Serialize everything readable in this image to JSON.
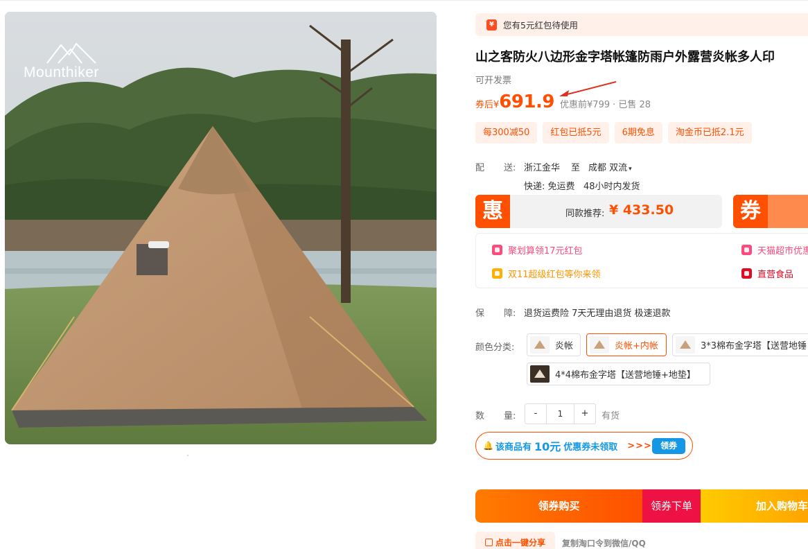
{
  "gallery": {
    "brand_name": "Mounthiker",
    "tent_label": "Mounthiker"
  },
  "redpacket": {
    "icon_glyph": "¥",
    "text": "您有5元红包待使用"
  },
  "product": {
    "title": "山之客防火八边形金字塔帐篷防雨户外露营炎帐多人印",
    "invoice": "可开发票"
  },
  "price": {
    "prefix": "券后¥",
    "main": "691.9",
    "original": "优惠前¥799",
    "sold": "· 已售 28"
  },
  "promos": [
    "每300减50",
    "红包已抵5元",
    "6期免息",
    "淘金币已抵2.1元"
  ],
  "delivery": {
    "label_a": "配",
    "label_b": "送:",
    "from": "浙江金华",
    "to_word": "至",
    "dest": "成都 双流",
    "express": "快递: 免运费",
    "ship_time": "48小时内发货"
  },
  "recommend": {
    "badge": "惠",
    "label": "同款推荐:",
    "price": "¥ 433.50",
    "coupon_badge": "券"
  },
  "benefits": {
    "item1": "聚划算领17元红包",
    "item2": "天猫超市优惠",
    "item3": "双11超级红包等你来领",
    "item4": "直营食品"
  },
  "guarantee": {
    "label_a": "保",
    "label_b": "障:",
    "text": "退货运费险 7天无理由退货 极速退款"
  },
  "sku": {
    "label": "颜色分类:",
    "options": [
      "炎帐",
      "炎帐+内帐",
      "3*3棉布金字塔【送营地锤",
      "4*4棉布金字塔【送营地锤+地垫】"
    ]
  },
  "quantity": {
    "label_a": "数",
    "label_b": "量:",
    "minus": "-",
    "value": "1",
    "plus": "+",
    "stock": "有货"
  },
  "coupon": {
    "bell": "🔔",
    "text_a": "该商品有",
    "amount": "10元",
    "text_b": "优惠券未领取",
    "arrows": ">>>",
    "button": "领券"
  },
  "actions": {
    "buy_coupon": "领券购买",
    "order_coupon": "领券下单",
    "add_cart": "加入购物车"
  },
  "share": {
    "button": "点击一键分享",
    "note": "复制淘口令到微信/QQ"
  },
  "colors": {
    "accent": "#ff4f00",
    "blue": "#1597e5",
    "magenta": "#ee1144",
    "yellow": "#ffcb00"
  }
}
